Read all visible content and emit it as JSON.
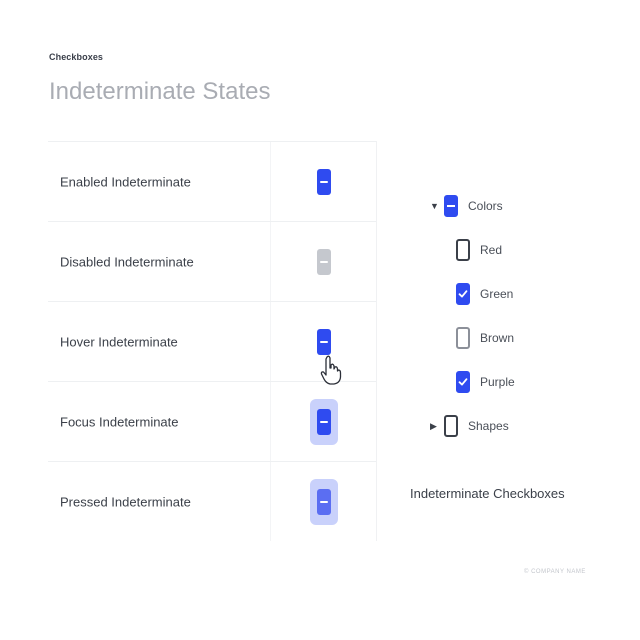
{
  "header": {
    "eyebrow": "Checkboxes",
    "title": "Indeterminate States"
  },
  "states": [
    {
      "label": "Enabled Indeterminate",
      "state": "enabled"
    },
    {
      "label": "Disabled Indeterminate",
      "state": "disabled"
    },
    {
      "label": "Hover Indeterminate",
      "state": "hover"
    },
    {
      "label": "Focus Indeterminate",
      "state": "focus"
    },
    {
      "label": "Pressed Indeterminate",
      "state": "pressed"
    }
  ],
  "tree": {
    "parent": {
      "label": "Colors",
      "state": "indeterminate",
      "expanded": true
    },
    "children": [
      {
        "label": "Red",
        "checked": false
      },
      {
        "label": "Green",
        "checked": true
      },
      {
        "label": "Brown",
        "checked": false
      },
      {
        "label": "Purple",
        "checked": true
      }
    ],
    "sibling": {
      "label": "Shapes",
      "state": "unchecked",
      "expanded": false
    }
  },
  "caption": "Indeterminate Checkboxes",
  "footer": "© COMPANY NAME",
  "colors": {
    "accent": "#2f4bf0",
    "focus_ring": "#c9d1fb",
    "disabled": "#c5c8ce"
  }
}
